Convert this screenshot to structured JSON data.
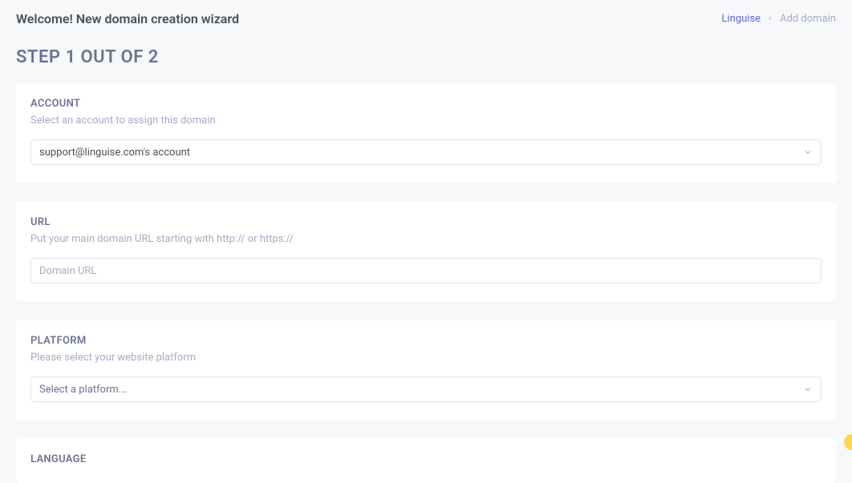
{
  "header": {
    "title": "Welcome! New domain creation wizard"
  },
  "breadcrumb": {
    "link": "Linguise",
    "current": "Add domain"
  },
  "step": {
    "title": "STEP 1 OUT OF 2"
  },
  "sections": {
    "account": {
      "label": "ACCOUNT",
      "sublabel": "Select an account to assign this domain",
      "selected": "support@linguise.com's account"
    },
    "url": {
      "label": "URL",
      "sublabel": "Put your main domain URL starting with http:// or https://",
      "placeholder": "Domain URL"
    },
    "platform": {
      "label": "PLATFORM",
      "sublabel": "Please select your website platform",
      "placeholder": "Select a platform..."
    },
    "language": {
      "label": "LANGUAGE"
    }
  }
}
